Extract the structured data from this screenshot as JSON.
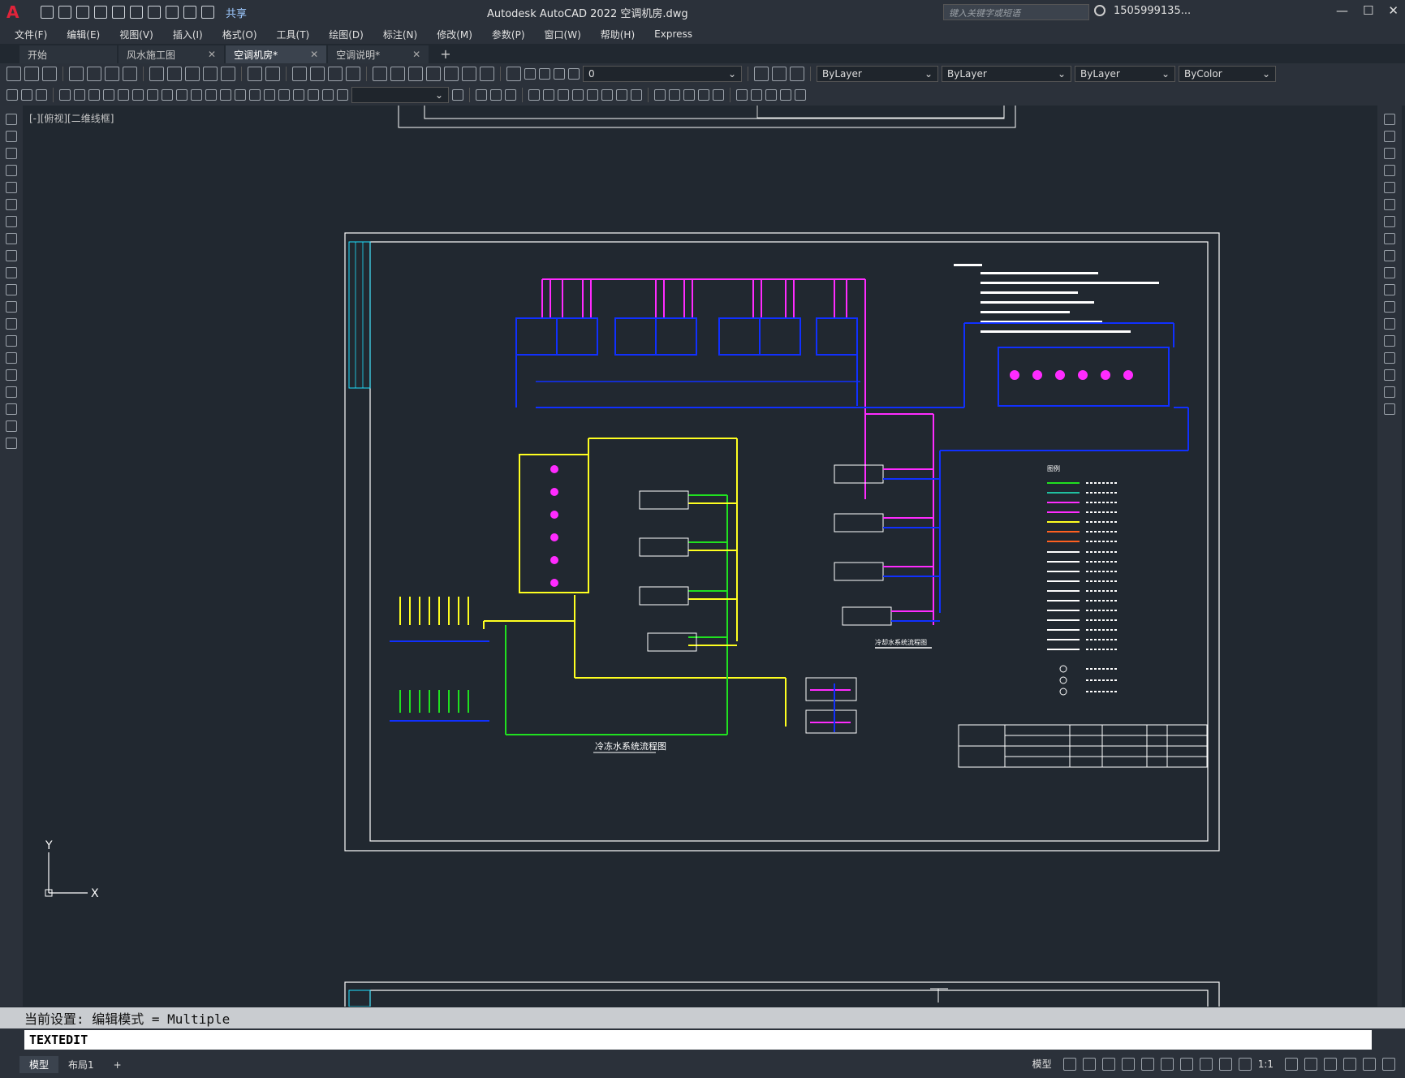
{
  "titlebar": {
    "logo": "A",
    "share": "共享",
    "title": "Autodesk AutoCAD 2022    空调机房.dwg",
    "search_placeholder": "键入关键字或短语",
    "user": "1505999135..."
  },
  "menu": [
    "文件(F)",
    "编辑(E)",
    "视图(V)",
    "插入(I)",
    "格式(O)",
    "工具(T)",
    "绘图(D)",
    "标注(N)",
    "修改(M)",
    "参数(P)",
    "窗口(W)",
    "帮助(H)",
    "Express"
  ],
  "tabs": [
    {
      "label": "开始",
      "active": false
    },
    {
      "label": "风水施工图",
      "active": false
    },
    {
      "label": "空调机房*",
      "active": true
    },
    {
      "label": "空调说明*",
      "active": false
    }
  ],
  "toolbar": {
    "layer_value": "0",
    "color_value": "ByLayer",
    "linetype_value": "ByLayer",
    "lineweight_value": "ByLayer",
    "plotstyle_value": "ByColor"
  },
  "viewport_label": "[-][俯视][二维线框]",
  "drawing": {
    "diagram_title": "冷冻水系统流程图",
    "diagram_title_2": "冷却水系统流程图",
    "legend_title": "图例",
    "ucs_x": "X",
    "ucs_y": "Y"
  },
  "command": {
    "history": "当前设置: 编辑模式 = Multiple",
    "input": "TEXTEDIT"
  },
  "status": {
    "tabs": [
      {
        "label": "模型",
        "active": true
      },
      {
        "label": "布局1",
        "active": false
      }
    ],
    "model": "模型",
    "scale": "1:1"
  },
  "colors": {
    "magenta": "#ff2bff",
    "blue": "#1030ff",
    "yellow": "#ffff20",
    "green": "#20e020",
    "cyan": "#20e0ff",
    "white": "#ffffff"
  }
}
